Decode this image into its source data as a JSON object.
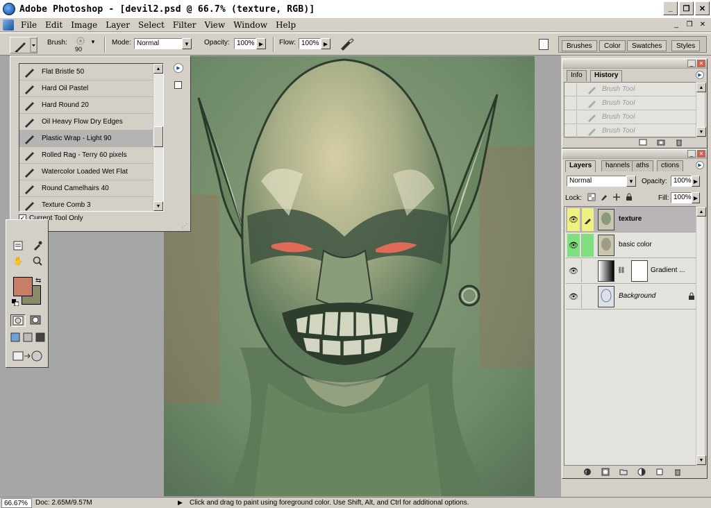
{
  "window": {
    "title": "Adobe Photoshop - [devil2.psd @ 66.7% (texture, RGB)]",
    "controls": [
      "_",
      "❐",
      "✕"
    ]
  },
  "menu": {
    "items": [
      "File",
      "Edit",
      "Image",
      "Layer",
      "Select",
      "Filter",
      "View",
      "Window",
      "Help"
    ],
    "mdi_controls": [
      "_",
      "❐",
      "✕"
    ]
  },
  "options": {
    "brush_label": "Brush:",
    "brush_size": "90",
    "mode_label": "Mode:",
    "mode_value": "Normal",
    "opacity_label": "Opacity:",
    "opacity_value": "100%",
    "flow_label": "Flow:",
    "flow_value": "100%"
  },
  "palette_well": {
    "tabs": [
      "Brushes",
      "Color",
      "Swatches",
      "Styles"
    ]
  },
  "brush_popup": {
    "items": [
      "Flat Bristle 50",
      "Hard Oil Pastel",
      "Hard Round 20",
      "Oil Heavy Flow Dry Edges",
      "Plastic Wrap - Light 90",
      "Rolled Rag - Terry 60 pixels",
      "Watercolor Loaded Wet Flat",
      "Round Camelhairs 40",
      "Texture Comb 3"
    ],
    "selected_index": 4,
    "current_tool_only_label": "Current Tool Only",
    "current_tool_only_checked": true
  },
  "history": {
    "tabs": [
      "Info",
      "History"
    ],
    "active_tab": "History",
    "items": [
      "Brush Tool",
      "Brush Tool",
      "Brush Tool",
      "Brush Tool"
    ]
  },
  "layers": {
    "tabs": [
      "Layers",
      "Channels",
      "Paths",
      "Actions"
    ],
    "visible_tabs": [
      "Layers",
      "hannels",
      "aths",
      "ctions"
    ],
    "blend_mode": "Normal",
    "opacity_label": "Opacity:",
    "opacity_value": "100%",
    "lock_label": "Lock:",
    "fill_label": "Fill:",
    "fill_value": "100%",
    "rows": [
      {
        "name": "texture",
        "selected": true
      },
      {
        "name": "basic color",
        "selected": false
      },
      {
        "name": "Gradient ...",
        "selected": false
      },
      {
        "name": "Background",
        "selected": false
      }
    ]
  },
  "colors": {
    "foreground": "#c87e66",
    "background": "#8a8a68"
  },
  "status": {
    "zoom": "66.67%",
    "doc": "Doc: 2.65M/9.57M",
    "hint": "Click and drag to paint using foreground color.  Use Shift, Alt, and Ctrl for additional options."
  }
}
